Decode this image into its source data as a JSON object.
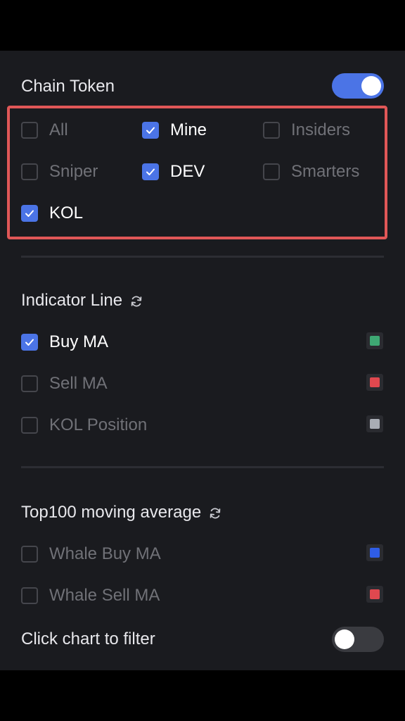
{
  "chain_token": {
    "title": "Chain Token",
    "toggle_on": true,
    "options": [
      {
        "label": "All",
        "checked": false
      },
      {
        "label": "Mine",
        "checked": true
      },
      {
        "label": "Insiders",
        "checked": false
      },
      {
        "label": "Sniper",
        "checked": false
      },
      {
        "label": "DEV",
        "checked": true
      },
      {
        "label": "Smarters",
        "checked": false
      },
      {
        "label": "KOL",
        "checked": true
      }
    ]
  },
  "indicator_line": {
    "title": "Indicator Line",
    "refresh_icon": "refresh-icon",
    "options": [
      {
        "label": "Buy MA",
        "checked": true,
        "color": "#3ea873"
      },
      {
        "label": "Sell MA",
        "checked": false,
        "color": "#e0484f"
      },
      {
        "label": "KOL Position",
        "checked": false,
        "color": "#a9adb5"
      }
    ]
  },
  "top100": {
    "title": "Top100 moving average",
    "refresh_icon": "refresh-icon",
    "options": [
      {
        "label": "Whale Buy MA",
        "checked": false,
        "color": "#2f5de6"
      },
      {
        "label": "Whale Sell MA",
        "checked": false,
        "color": "#e0484f"
      }
    ]
  },
  "click_chart": {
    "label": "Click chart to filter",
    "toggle_on": false
  },
  "colors": {
    "accent": "#4b74e6",
    "highlight_border": "#e05757",
    "panel_bg": "#1a1b1f"
  }
}
